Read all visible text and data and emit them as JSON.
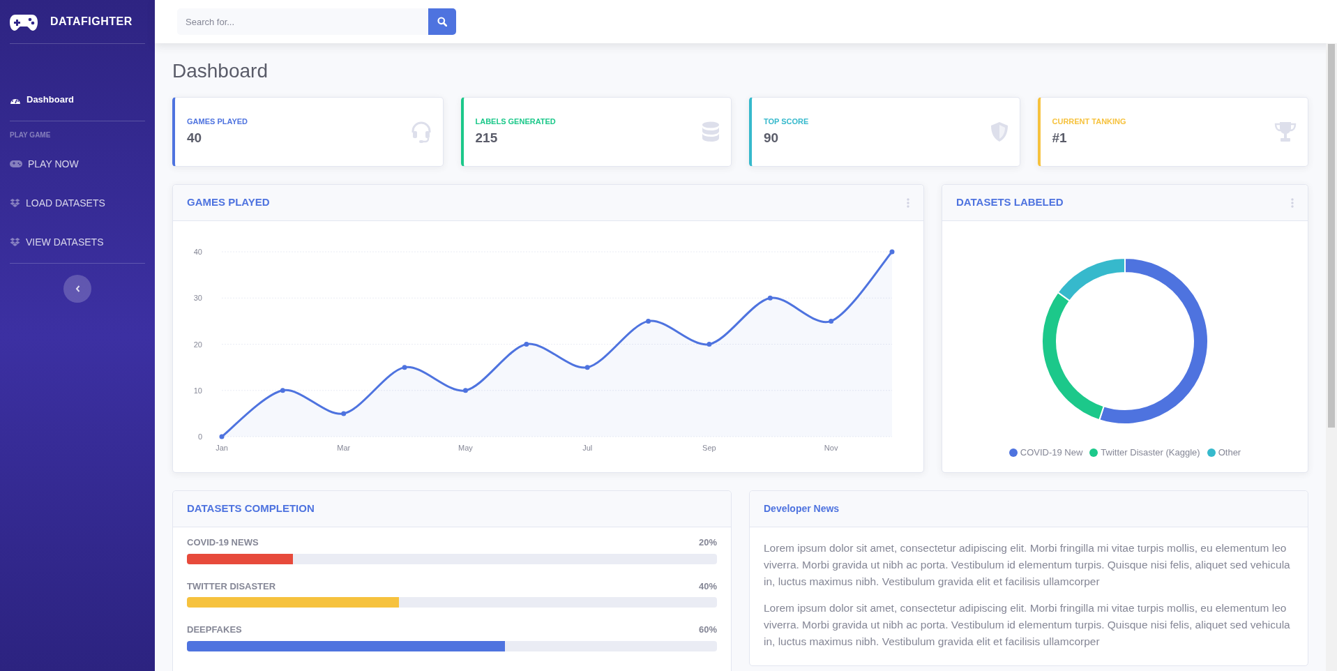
{
  "brand": {
    "name": "DATAFIGHTER"
  },
  "search": {
    "placeholder": "Search for..."
  },
  "sidebar": {
    "items": [
      {
        "kind": "link",
        "label": "Dashboard",
        "selected": true
      },
      {
        "kind": "heading",
        "label": "PLAY GAME"
      },
      {
        "kind": "link",
        "label": "PLAY NOW",
        "selected": false
      },
      {
        "kind": "link",
        "label": "LOAD DATASETS",
        "selected": false
      },
      {
        "kind": "link",
        "label": "VIEW DATASETS",
        "selected": false
      }
    ]
  },
  "page_title": "Dashboard",
  "stat_cards": [
    {
      "label": "GAMES PLAYED",
      "value": "40",
      "color": "#4e73df"
    },
    {
      "label": "LABELS GENERATED",
      "value": "215",
      "color": "#1cc88a"
    },
    {
      "label": "TOP SCORE",
      "value": "90",
      "color": "#36b9cc"
    },
    {
      "label": "CURRENT TANKING",
      "value": "#1",
      "color": "#f6c23e"
    }
  ],
  "games_chart": {
    "title": "GAMES PLAYED",
    "chart_data": {
      "type": "area",
      "categories": [
        "Jan",
        null,
        "Mar",
        null,
        "May",
        null,
        "Jul",
        null,
        "Sep",
        null,
        "Nov",
        null
      ],
      "series": [
        {
          "color": "#4e73df",
          "values": [
            0,
            10,
            5,
            15,
            10,
            20,
            15,
            25,
            20,
            30,
            25,
            40
          ]
        }
      ],
      "yticks": [
        0,
        10,
        20,
        30,
        40
      ],
      "ylim": [
        0,
        40
      ],
      "grid": true
    }
  },
  "datasets_chart": {
    "title": "DATASETS LABELED",
    "chart_data": {
      "type": "donut",
      "categories": [
        "COVID-19 New",
        "Twitter Disaster (Kaggle)",
        "Other"
      ],
      "series": [
        {
          "values": [
            55,
            30,
            15
          ]
        }
      ],
      "colors": [
        "#4e73df",
        "#1cc88a",
        "#36b9cc"
      ],
      "legend": "bottom"
    }
  },
  "completion": {
    "title": "DATASETS COMPLETION",
    "rows": [
      {
        "label": "COVID-19 NEWS",
        "reading": "20%",
        "level": 0.2,
        "color": "#e74a3b"
      },
      {
        "label": "TWITTER DISASTER",
        "reading": "40%",
        "level": 0.4,
        "color": "#f6c23e"
      },
      {
        "label": "DEEPFAKES",
        "reading": "60%",
        "level": 0.6,
        "color": "#4e73df"
      }
    ]
  },
  "news": {
    "title": "Developer News",
    "paragraphs": [
      "Lorem ipsum dolor sit amet, consectetur adipiscing elit. Morbi fringilla mi vitae turpis mollis, eu elementum leo viverra. Morbi gravida ut nibh ac porta. Vestibulum id elementum turpis. Quisque nisi felis, aliquet sed vehicula in, luctus maximus nibh. Vestibulum gravida elit et facilisis ullamcorper",
      "Lorem ipsum dolor sit amet, consectetur adipiscing elit. Morbi fringilla mi vitae turpis mollis, eu elementum leo viverra. Morbi gravida ut nibh ac porta. Vestibulum id elementum turpis. Quisque nisi felis, aliquet sed vehicula in, luctus maximus nibh. Vestibulum gravida elit et facilisis ullamcorper"
    ]
  }
}
